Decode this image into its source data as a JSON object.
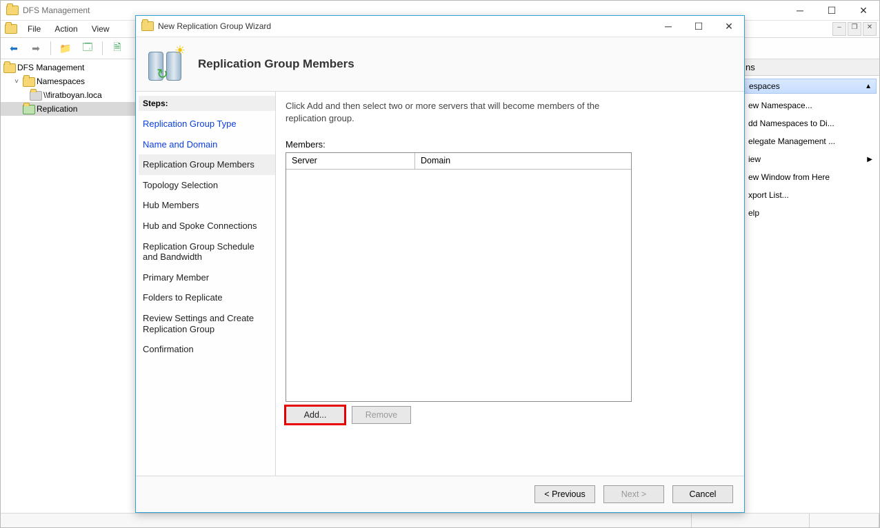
{
  "main_window": {
    "title": "DFS Management",
    "menus": [
      "File",
      "Action",
      "View"
    ],
    "tree": {
      "root": "DFS Management",
      "items": [
        {
          "label": "Namespaces",
          "expanded": true,
          "children": [
            {
              "label": "\\\\firatboyan.loca"
            }
          ]
        },
        {
          "label": "Replication",
          "selected": true
        }
      ]
    },
    "actions": {
      "pane_title": "ns",
      "group_header": "espaces",
      "links": [
        "ew Namespace...",
        "dd Namespaces to Di...",
        "elegate Management ...",
        "iew",
        "ew Window from Here",
        "xport List...",
        "elp"
      ]
    }
  },
  "dialog": {
    "title": "New Replication Group Wizard",
    "header_title": "Replication Group Members",
    "steps_title": "Steps:",
    "steps": [
      {
        "label": "Replication Group Type",
        "state": "done"
      },
      {
        "label": "Name and Domain",
        "state": "done"
      },
      {
        "label": "Replication Group Members",
        "state": "current"
      },
      {
        "label": "Topology Selection",
        "state": ""
      },
      {
        "label": "Hub Members",
        "state": ""
      },
      {
        "label": "Hub and Spoke Connections",
        "state": ""
      },
      {
        "label": "Replication Group Schedule and Bandwidth",
        "state": ""
      },
      {
        "label": "Primary Member",
        "state": ""
      },
      {
        "label": "Folders to Replicate",
        "state": ""
      },
      {
        "label": "Review Settings and Create Replication Group",
        "state": ""
      },
      {
        "label": "Confirmation",
        "state": ""
      }
    ],
    "instructions": "Click Add and then select two or more servers that will become members of the replication group.",
    "members_label": "Members:",
    "columns": {
      "server": "Server",
      "domain": "Domain"
    },
    "buttons": {
      "add": "Add...",
      "remove": "Remove",
      "previous": "< Previous",
      "next": "Next >",
      "cancel": "Cancel"
    }
  }
}
